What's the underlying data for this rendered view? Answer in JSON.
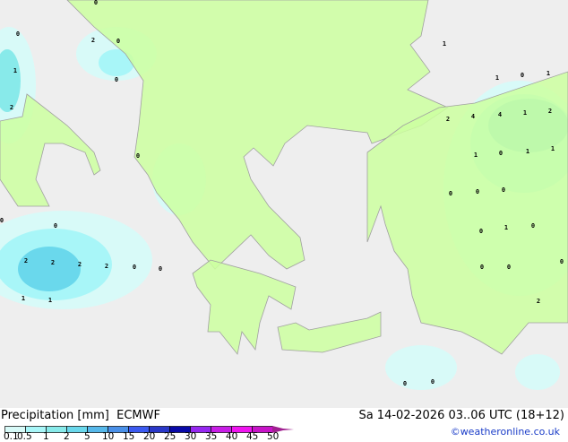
{
  "header": {
    "title": "Precipitation [mm]  ECMWF",
    "valid": "Sa 14-02-2026 03..06 UTC (18+12)",
    "credit": "©weatheronline.co.uk"
  },
  "colors": {
    "sea": "#eeeeee",
    "land": "#ccffa0",
    "border": "#a0a0a0"
  },
  "legend": {
    "ticks": [
      "0.1",
      "0.5",
      "1",
      "2",
      "5",
      "10",
      "15",
      "20",
      "25",
      "30",
      "35",
      "40",
      "45",
      "50"
    ],
    "colors": [
      "#d8faf8",
      "#a8f6f8",
      "#88eaea",
      "#6ad8ec",
      "#56b8ea",
      "#4a90e8",
      "#3c5af0",
      "#2a38c8",
      "#0a0aa8",
      "#9628f0",
      "#c81ee6",
      "#f014f0",
      "#c814c8"
    ],
    "overflow_color": "#a02090"
  },
  "map_labels": [
    "0",
    "0",
    "2",
    "0",
    "0",
    "1",
    "2",
    "0",
    "2",
    "2",
    "2",
    "2",
    "0",
    "0",
    "1",
    "1",
    "0",
    "0",
    "1",
    "1",
    "0",
    "1",
    "2",
    "4",
    "4",
    "1",
    "2",
    "1",
    "0",
    "1",
    "1",
    "0",
    "0",
    "0",
    "1",
    "0",
    "0",
    "0",
    "0",
    "2",
    "0",
    "0",
    "0"
  ]
}
